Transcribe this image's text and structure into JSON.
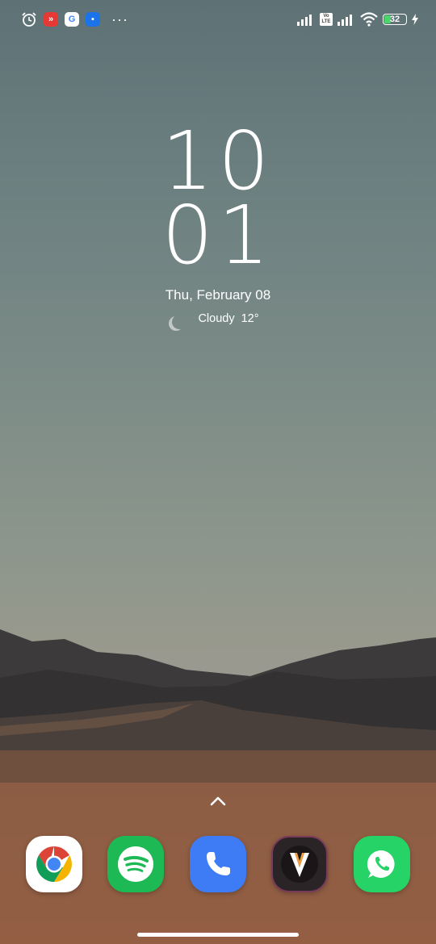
{
  "status_bar": {
    "left_icons": [
      "alarm-icon",
      "app-notification-red-icon",
      "google-icon",
      "app-notification-blue-icon"
    ],
    "more_indicator": "···",
    "volte_label": "Vo LTE",
    "battery_level": "32",
    "battery_color": "#4bd66b",
    "charging": true
  },
  "clock": {
    "hours": "10",
    "minutes": "01"
  },
  "date": "Thu, February 08",
  "weather": {
    "condition": "Cloudy",
    "temperature": "12°"
  },
  "dock": {
    "apps": [
      {
        "name": "Chrome",
        "icon": "chrome-icon"
      },
      {
        "name": "Spotify",
        "icon": "spotify-icon"
      },
      {
        "name": "Phone",
        "icon": "phone-icon"
      },
      {
        "name": "V app",
        "icon": "v-app-icon",
        "letter": "V"
      },
      {
        "name": "WhatsApp",
        "icon": "whatsapp-icon"
      }
    ]
  },
  "colors": {
    "spotify": "#1db954",
    "phone": "#3d7cf5",
    "whatsapp": "#25d366"
  }
}
